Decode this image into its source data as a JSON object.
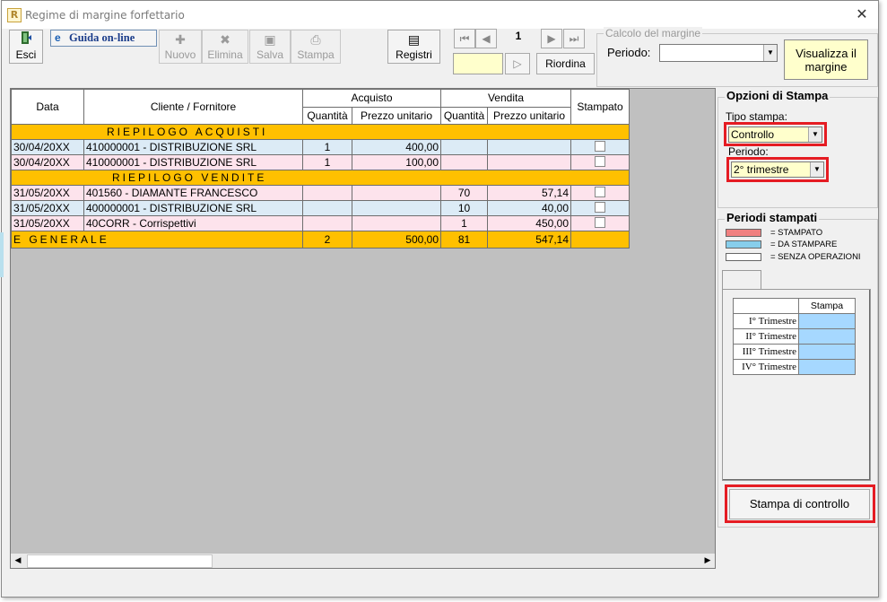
{
  "window": {
    "title": "Regime di margine forfettario",
    "app_icon": "R",
    "close": "✕"
  },
  "toolbar": {
    "esci": "Esci",
    "guida": "Guida on-line",
    "nuovo": "Nuovo",
    "elimina": "Elimina",
    "salva": "Salva",
    "stampa": "Stampa",
    "registri": "Registri",
    "page_number": "1",
    "riordina": "Riordina"
  },
  "calcolo": {
    "title": "Calcolo del margine",
    "periodo_label": "Periodo:",
    "periodo_value": "",
    "visualizza": "Visualizza il margine"
  },
  "grid": {
    "headers": {
      "data": "Data",
      "cliente": "Cliente / Fornitore",
      "acquisto": "Acquisto",
      "vendita": "Vendita",
      "stampato": "Stampato",
      "quantita": "Quantità",
      "prezzo": "Prezzo unitario"
    },
    "sections": {
      "acquisti": "RIEPILOGO ACQUISTI",
      "vendite": "RIEPILOGO VENDITE"
    },
    "purchases": [
      {
        "data": "30/04/20XX",
        "cliente": "410000001 - DISTRIBUZIONE SRL",
        "qta_acq": "1",
        "prezzo_acq": "400,00",
        "qta_ven": "",
        "prezzo_ven": ""
      },
      {
        "data": "30/04/20XX",
        "cliente": "410000001 - DISTRIBUZIONE SRL",
        "qta_acq": "1",
        "prezzo_acq": "100,00",
        "qta_ven": "",
        "prezzo_ven": ""
      }
    ],
    "sales": [
      {
        "data": "31/05/20XX",
        "cliente": "401560 - DIAMANTE FRANCESCO",
        "qta_acq": "",
        "prezzo_acq": "",
        "qta_ven": "70",
        "prezzo_ven": "57,14"
      },
      {
        "data": "31/05/20XX",
        "cliente": "400000001 - DISTRIBUZIONE SRL",
        "qta_acq": "",
        "prezzo_acq": "",
        "qta_ven": "10",
        "prezzo_ven": "40,00"
      },
      {
        "data": "31/05/20XX",
        "cliente": "40CORR - Corrispettivi",
        "qta_acq": "",
        "prezzo_acq": "",
        "qta_ven": "1",
        "prezzo_ven": "450,00"
      }
    ],
    "total": {
      "label": "E  GENERALE",
      "qta_acq": "2",
      "prezzo_acq": "500,00",
      "qta_ven": "81",
      "prezzo_ven": "547,14"
    }
  },
  "opzioni": {
    "title": "Opzioni di Stampa",
    "tipo_label": "Tipo stampa:",
    "tipo_value": "Controllo",
    "periodo_label": "Periodo:",
    "periodo_value": "2° trimestre"
  },
  "periodi": {
    "title": "Periodi stampati",
    "legend": [
      {
        "color": "#f08080",
        "label": "= STAMPATO"
      },
      {
        "color": "#87ceeb",
        "label": "= DA STAMPARE"
      },
      {
        "color": "#ffffff",
        "label": "= SENZA OPERAZIONI"
      }
    ],
    "header": "Stampa",
    "rows": [
      "I° Trimestre",
      "II° Trimestre",
      "III° Trimestre",
      "IV° Trimestre"
    ]
  },
  "stampa_controllo": "Stampa di controllo",
  "colors": {
    "section": "#ffc000",
    "row_blue": "#dcebf6",
    "row_pink": "#fde3ec",
    "highlight": "#e51c23"
  }
}
